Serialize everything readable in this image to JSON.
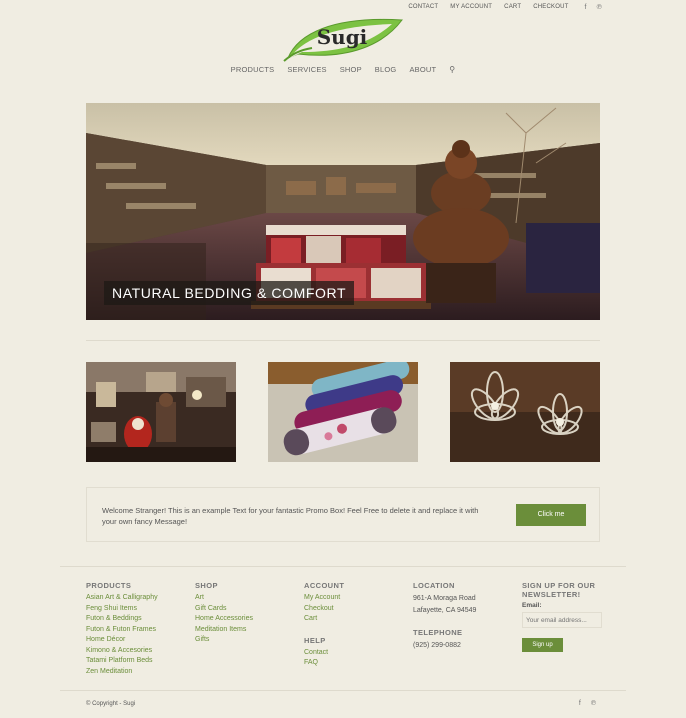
{
  "top_nav": {
    "links": [
      "CONTACT",
      "MY ACCOUNT",
      "CART",
      "CHECKOUT"
    ],
    "social": [
      "facebook-icon",
      "pinterest-icon"
    ]
  },
  "logo": {
    "text": "Sugi",
    "leaf_color": "#7cc242"
  },
  "main_nav": {
    "items": [
      "PRODUCTS",
      "SERVICES",
      "SHOP",
      "BLOG",
      "ABOUT"
    ],
    "search_icon": "search-icon"
  },
  "hero": {
    "caption": "NATURAL BEDDING & COMFORT"
  },
  "promo": {
    "text": "Welcome Stranger! This is an example Text for your fantastic Promo Box! Feel Free to delete it and replace it with your own fancy Message!",
    "button_label": "Click me"
  },
  "footer": {
    "products": {
      "title": "PRODUCTS",
      "items": [
        "Asian Art & Calligraphy",
        "Feng Shui Items",
        "Futon & Beddings",
        "Futon & Futon Frames",
        "Home Décor",
        "Kimono & Accesories",
        "Tatami Platform Beds",
        "Zen Meditation"
      ]
    },
    "shop": {
      "title": "SHOP",
      "items": [
        "Art",
        "Gift Cards",
        "Home Accessories",
        "Meditation Items",
        "Gifts"
      ]
    },
    "account": {
      "title": "ACCOUNT",
      "items": [
        "My Account",
        "Checkout",
        "Cart"
      ]
    },
    "help": {
      "title": "HELP",
      "items": [
        "Contact",
        "FAQ"
      ]
    },
    "location": {
      "title": "LOCATION",
      "lines": [
        "961-A Moraga Road",
        "Lafayette, CA 94549"
      ]
    },
    "telephone": {
      "title": "TELEPHONE",
      "number": "(925) 299-0882"
    },
    "newsletter": {
      "title": "SIGN UP FOR OUR NEWSLETTER!",
      "email_label": "Email:",
      "placeholder": "Your email address...",
      "button_label": "Sign up"
    }
  },
  "copyright": "© Copyright - Sugi",
  "colors": {
    "accent": "#6b8e3a",
    "background": "#f0ede2"
  }
}
